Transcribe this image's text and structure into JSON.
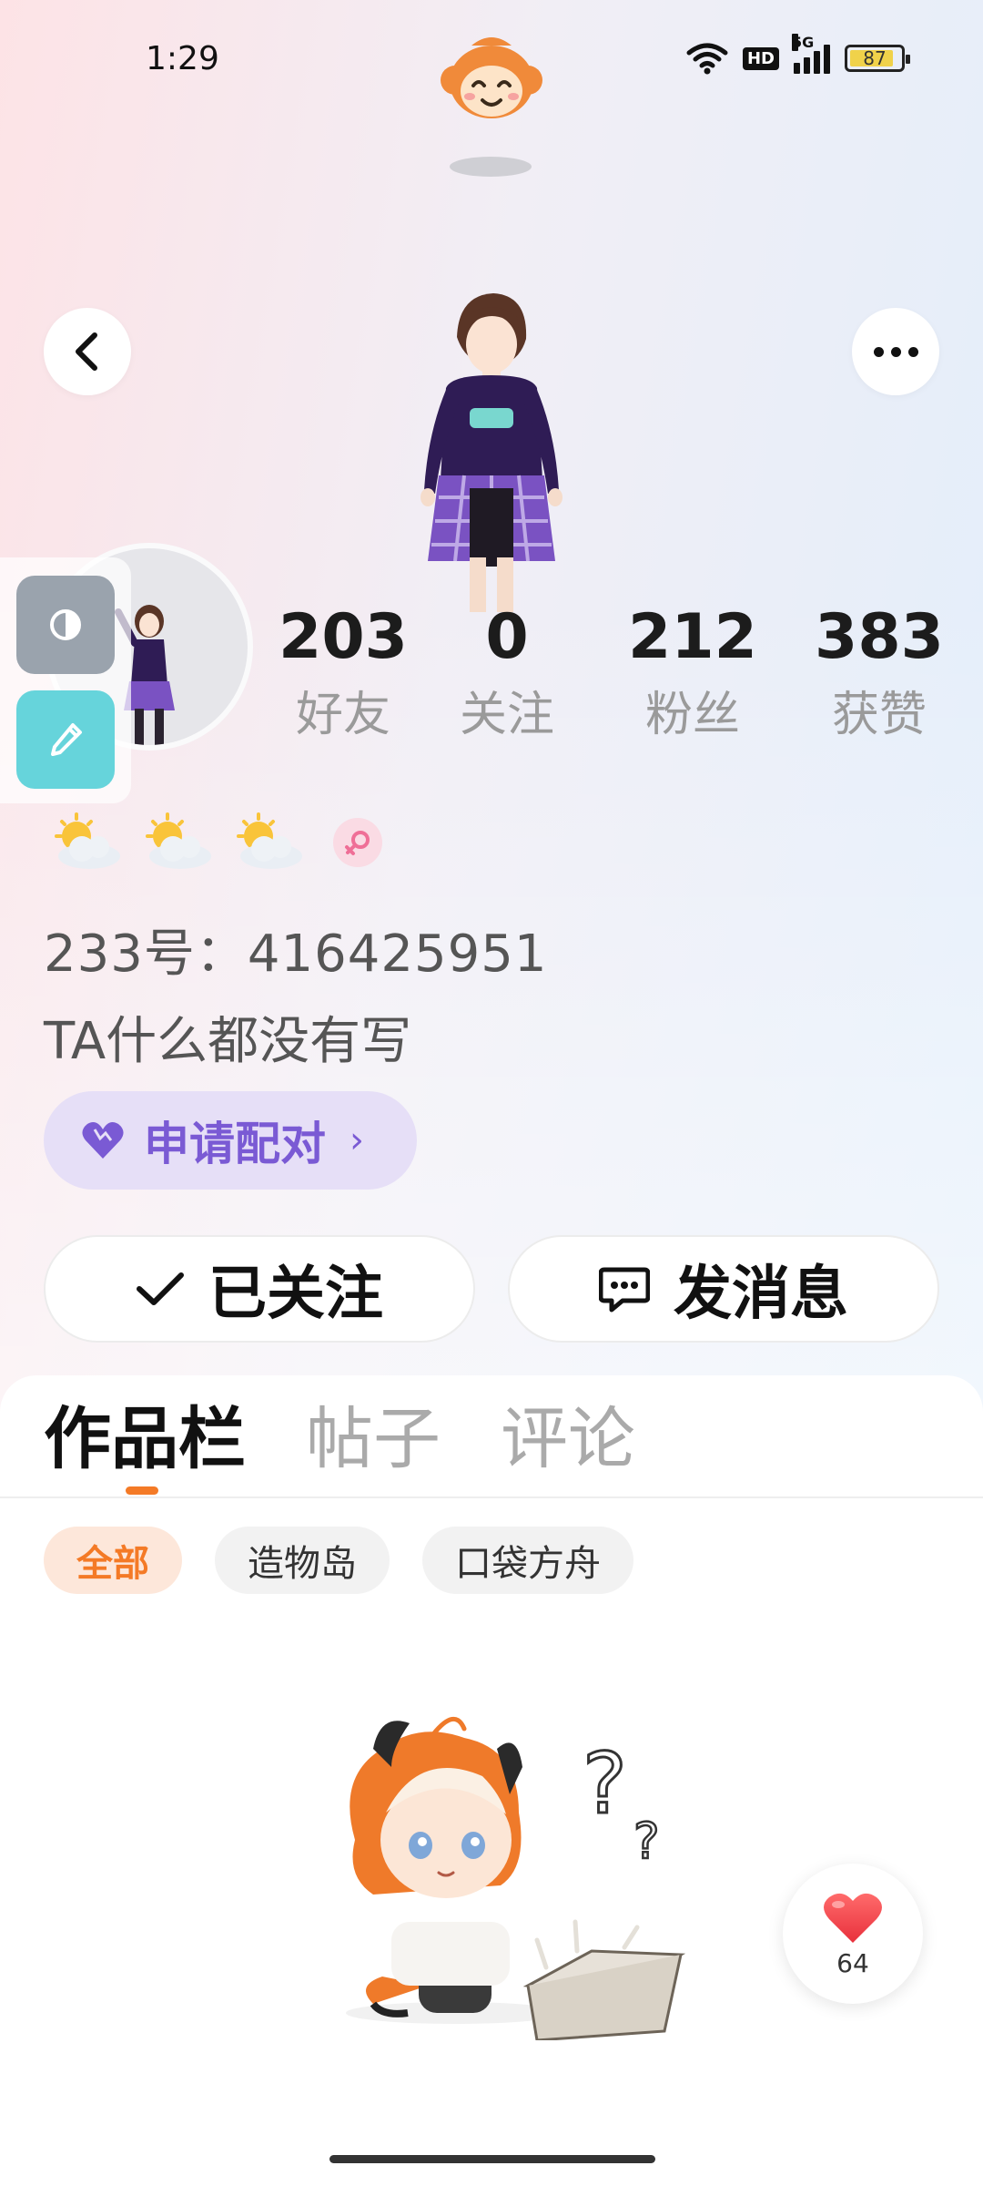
{
  "status_bar": {
    "time": "1:29",
    "network_badge": "HD",
    "signal_label": "5G",
    "battery_level": "87"
  },
  "profile": {
    "stats": [
      {
        "value": "203",
        "label": "好友"
      },
      {
        "value": "0",
        "label": "关注"
      },
      {
        "value": "212",
        "label": "粉丝"
      },
      {
        "value": "383",
        "label": "获赞"
      }
    ],
    "badges": [
      "sun-cloud-icon",
      "sun-cloud-icon",
      "sun-cloud-icon",
      "female-icon"
    ],
    "user_id": "233号：416425951",
    "bio": "TA什么都没有写",
    "pair_button_label": "申请配对",
    "follow_button_label": "已关注",
    "message_button_label": "发消息"
  },
  "tabs": [
    {
      "label": "作品栏",
      "active": true
    },
    {
      "label": "帖子",
      "active": false
    },
    {
      "label": "评论",
      "active": false
    }
  ],
  "filter_chips": [
    {
      "label": "全部",
      "active": true
    },
    {
      "label": "造物岛",
      "active": false
    },
    {
      "label": "口袋方舟",
      "active": false
    }
  ],
  "like_button": {
    "count": "64"
  },
  "colors": {
    "accent_orange": "#f47a26",
    "pair_purple": "#7a5ad4",
    "tool_gray": "#9aa3ad",
    "tool_cyan": "#66d4db",
    "like_red": "#f0474f"
  }
}
